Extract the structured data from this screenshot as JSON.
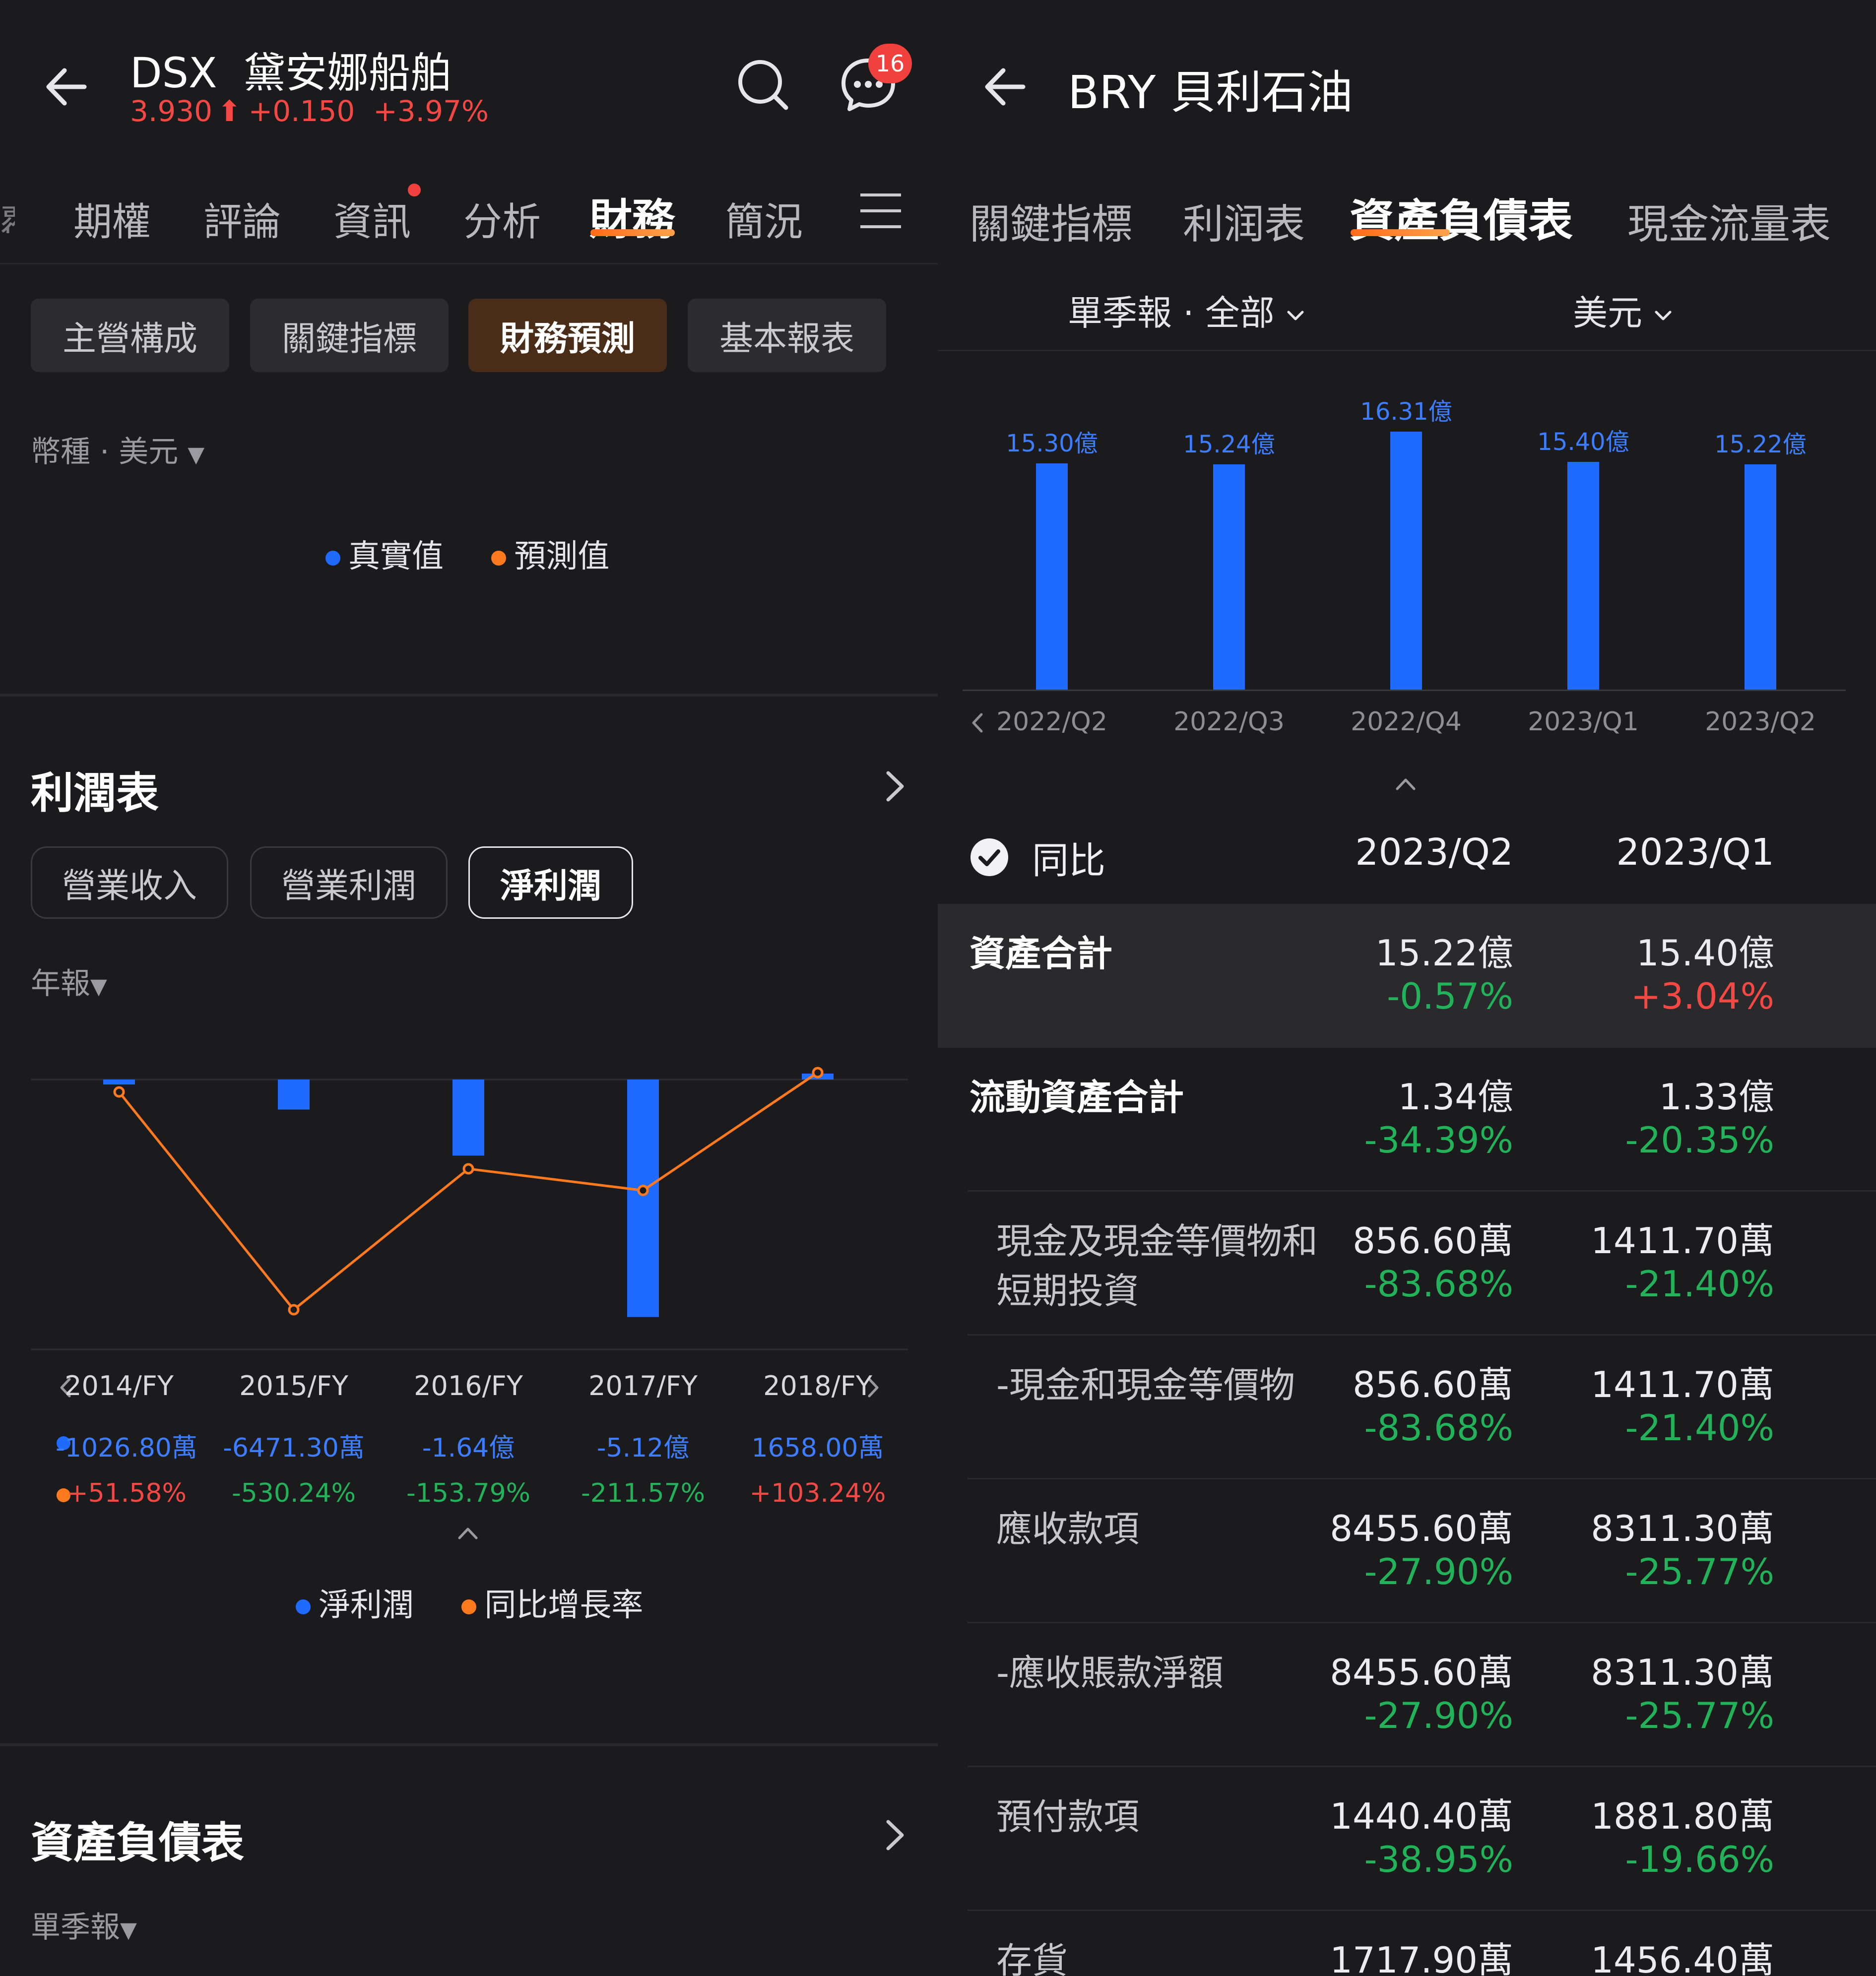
{
  "left": {
    "ticker": "DSX",
    "name": "黛安娜船舶",
    "price": "3.930",
    "change": "+0.150",
    "change_pct": "+3.97%",
    "notif_count": "16",
    "tabs": [
      "期權",
      "評論",
      "資訊",
      "分析",
      "財務",
      "簡況"
    ],
    "active_tab": "財務",
    "sub_tabs": [
      "主營構成",
      "關鍵指標",
      "財務預測",
      "基本報表"
    ],
    "currency_label": "幣種 · 美元",
    "legend_actual": "真實值",
    "legend_forecast": "預測值",
    "income": {
      "title": "利潤表",
      "pills": [
        "營業收入",
        "營業利潤",
        "淨利潤"
      ],
      "period": "年報",
      "legend_net": "淨利潤",
      "legend_yoy": "同比增長率"
    },
    "balance": {
      "title": "資產負債表",
      "period": "單季報"
    }
  },
  "chart_data": [
    {
      "type": "bar",
      "categories": [
        "2014/FY",
        "2015/FY",
        "2016/FY",
        "2017/FY",
        "2018/FY"
      ],
      "series": [
        {
          "name": "淨利潤",
          "values": [
            -1026.8,
            -6471.3,
            -16400,
            -51200,
            1658.0
          ],
          "labels": [
            "-1026.80萬",
            "-6471.30萬",
            "-1.64億",
            "-5.12億",
            "1658.00萬"
          ]
        },
        {
          "name": "同比增長率",
          "type": "line",
          "values": [
            51.58,
            -530.24,
            -153.79,
            -211.57,
            103.24
          ],
          "labels": [
            "+51.58%",
            "-530.24%",
            "-153.79%",
            "-211.57%",
            "+103.24%"
          ]
        }
      ]
    },
    {
      "type": "bar",
      "categories": [
        "2022/Q2",
        "2022/Q3",
        "2022/Q4",
        "2023/Q1",
        "2023/Q2"
      ],
      "series": [
        {
          "name": "資產合計",
          "values": [
            15.3,
            15.24,
            16.31,
            15.4,
            15.22
          ],
          "labels": [
            "15.30億",
            "15.24億",
            "16.31億",
            "15.40億",
            "15.22億"
          ]
        }
      ]
    }
  ],
  "right": {
    "ticker": "BRY",
    "name": "貝利石油",
    "tabs": [
      "關鍵指標",
      "利润表",
      "資產負債表",
      "現金流量表"
    ],
    "active_tab": "資產負債表",
    "period_select": "單季報 · 全部",
    "currency_select": "美元",
    "yoy_label": "同比",
    "col1": "2023/Q2",
    "col2": "2023/Q1",
    "rows": [
      {
        "name": "資產合計",
        "v1": "15.22億",
        "p1": "-0.57%",
        "v2": "15.40億",
        "p2": "+3.04%"
      },
      {
        "name": "流動資產合計",
        "v1": "1.34億",
        "p1": "-34.39%",
        "v2": "1.33億",
        "p2": "-20.35%"
      },
      {
        "name": "現金及現金等價物和",
        "name2": "短期投資",
        "v1": "856.60萬",
        "p1": "-83.68%",
        "v2": "1411.70萬",
        "p2": "-21.40%"
      },
      {
        "name": "-現金和現金等價物",
        "v1": "856.60萬",
        "p1": "-83.68%",
        "v2": "1411.70萬",
        "p2": "-21.40%"
      },
      {
        "name": "應收款項",
        "v1": "8455.60萬",
        "p1": "-27.90%",
        "v2": "8311.30萬",
        "p2": "-25.77%"
      },
      {
        "name": "-應收賬款淨額",
        "v1": "8455.60萬",
        "p1": "-27.90%",
        "v2": "8311.30萬",
        "p2": "-25.77%"
      },
      {
        "name": "預付款項",
        "v1": "1440.40萬",
        "p1": "-38.95%",
        "v2": "1881.80萬",
        "p2": "-19.66%"
      },
      {
        "name": "存貨",
        "v1": "1717.90萬",
        "v2": "1456.40萬"
      }
    ]
  }
}
